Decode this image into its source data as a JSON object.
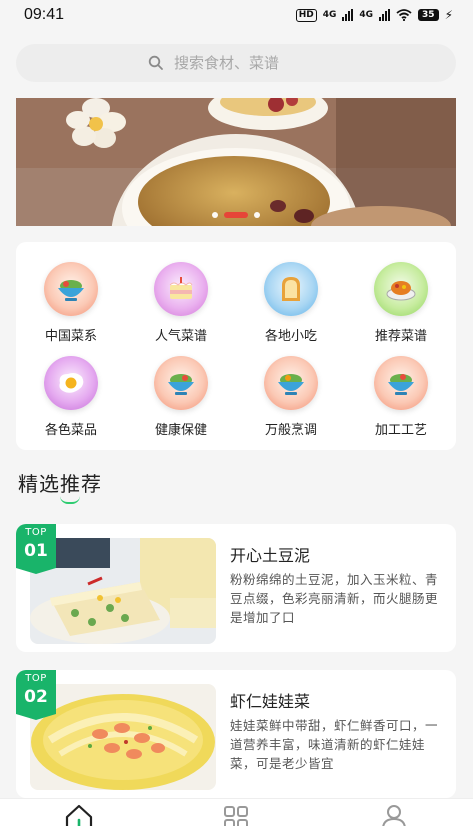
{
  "status_bar": {
    "time": "09:41",
    "indicators": [
      "HD",
      "4G",
      "4G"
    ],
    "battery": "35"
  },
  "search": {
    "placeholder": "搜索食材、菜谱",
    "icon": "search-icon"
  },
  "banner": {
    "dot_count": 3,
    "active_index": 1
  },
  "categories": [
    {
      "label": "中国菜系",
      "icon": "salad-bowl-icon",
      "color": "#f28b6e"
    },
    {
      "label": "人气菜谱",
      "icon": "cake-icon",
      "color": "#d173d8"
    },
    {
      "label": "各地小吃",
      "icon": "toast-icon",
      "color": "#5bb0e8"
    },
    {
      "label": "推荐菜谱",
      "icon": "dish-icon",
      "color": "#8ed35a"
    },
    {
      "label": "各色菜品",
      "icon": "egg-icon",
      "color": "#c36ad6"
    },
    {
      "label": "健康保健",
      "icon": "salad-bowl-icon",
      "color": "#f28b6e"
    },
    {
      "label": "万般烹调",
      "icon": "salad-bowl-icon",
      "color": "#f28b6e"
    },
    {
      "label": "加工工艺",
      "icon": "salad-bowl-icon",
      "color": "#f28b6e"
    }
  ],
  "section": {
    "title": "精选推荐"
  },
  "recommendations": [
    {
      "tag_top": "TOP",
      "tag_num": "01",
      "title": "开心土豆泥",
      "desc": "粉粉绵绵的土豆泥，加入玉米粒、青豆点缀，色彩亮丽清新，而火腿肠更是增加了口"
    },
    {
      "tag_top": "TOP",
      "tag_num": "02",
      "title": "虾仁娃娃菜",
      "desc": "娃娃菜鲜中带甜，虾仁鲜香可口，一道营养丰富，味道清新的虾仁娃娃菜，可是老少皆宜"
    }
  ],
  "tabs": [
    {
      "icon": "home-icon",
      "active": true
    },
    {
      "icon": "grid-icon",
      "active": false
    },
    {
      "icon": "user-icon",
      "active": false
    }
  ],
  "colors": {
    "accent": "#19b46a",
    "banner_dot_active": "#e84037"
  }
}
